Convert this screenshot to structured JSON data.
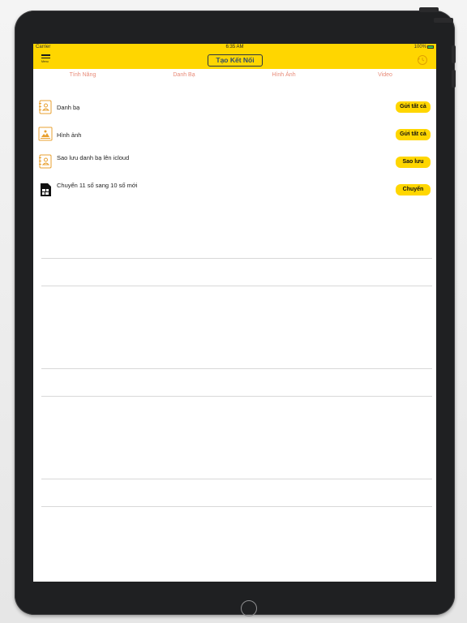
{
  "status_bar": {
    "carrier": "Carrier",
    "time": "6:35 AM",
    "battery": "100%"
  },
  "nav": {
    "menu_label": "Menu",
    "connect_label": "Tạo Kết Nối"
  },
  "tabs": [
    {
      "label": "Tính Năng"
    },
    {
      "label": "Danh Bạ"
    },
    {
      "label": "Hình Ảnh"
    },
    {
      "label": "Video"
    }
  ],
  "features": [
    {
      "label": "Danh bạ",
      "button": "Gửi tất cả",
      "icon": "contact-book-icon"
    },
    {
      "label": "Hình ảnh",
      "button": "Gửi tất cả",
      "icon": "photo-icon"
    },
    {
      "label": "Sao lưu danh bạ lên icloud",
      "button": "Sao lưu",
      "icon": "contact-backup-icon"
    },
    {
      "label": "Chuyển 11 số sang 10 số mới",
      "button": "Chuyển",
      "icon": "sim-card-icon"
    }
  ],
  "colors": {
    "accent": "#ffd600",
    "tab_text": "#e88a78",
    "device": "#1f2022"
  }
}
